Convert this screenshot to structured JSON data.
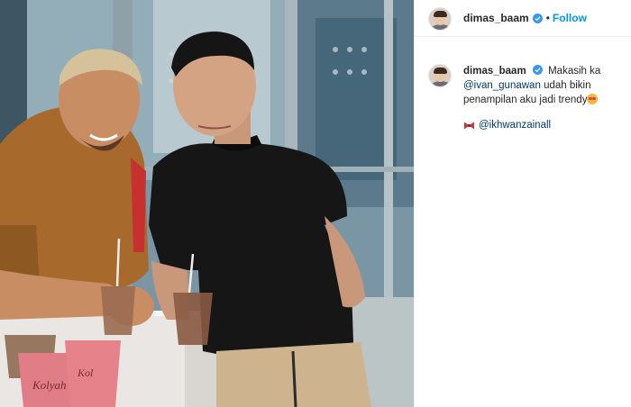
{
  "header": {
    "username": "dimas_baam",
    "dot": "•",
    "follow_label": "Follow"
  },
  "caption": {
    "username": "dimas_baam",
    "text_before": "Makasih ka",
    "mention_1": "@ivan_gunawan",
    "text_after": "udah bikin penampilan aku jadi trendy",
    "mention_2": "@ikhwanzainall"
  },
  "icons": {
    "verified": "verified-badge-icon",
    "tag": "bow-ribbon-icon",
    "emoji": "star-struck-emoji-icon"
  },
  "colors": {
    "follow": "#0095f6",
    "verified": "#3897f0",
    "mention": "#00376b"
  }
}
